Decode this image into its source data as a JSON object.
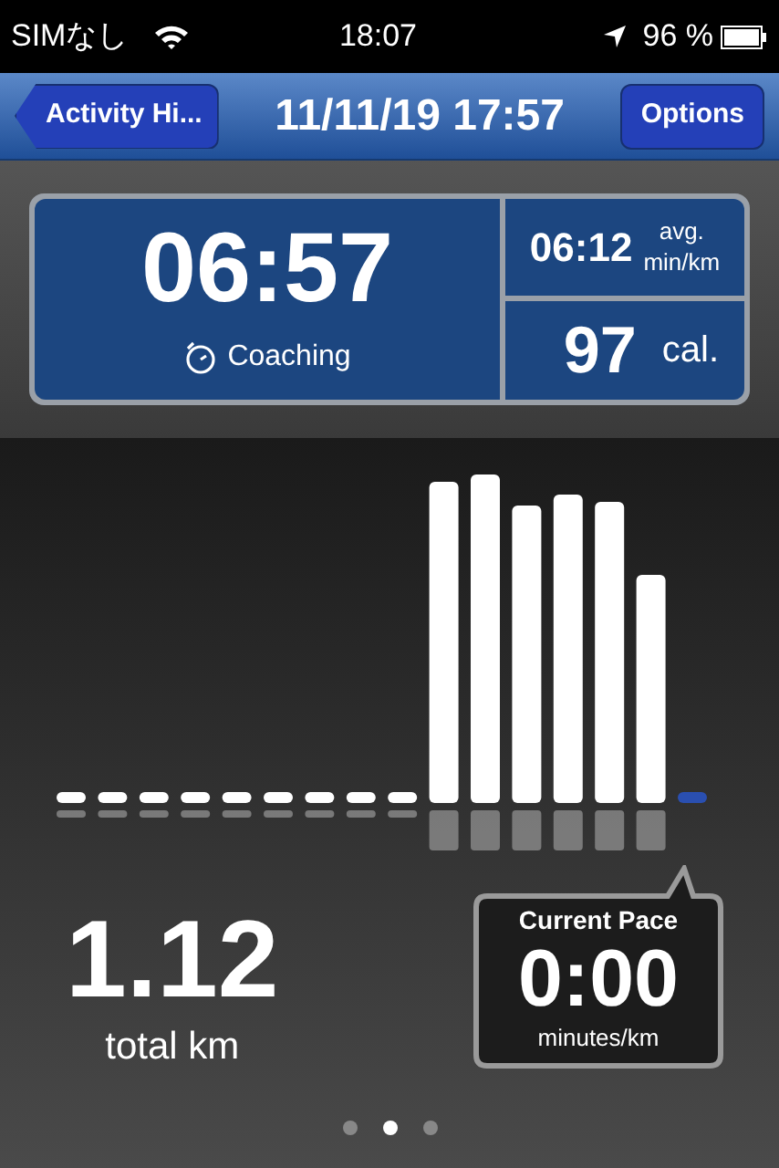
{
  "status_bar": {
    "carrier": "SIMなし",
    "time": "18:07",
    "battery": "96 %"
  },
  "nav": {
    "back": "Activity Hi...",
    "title": "11/11/19 17:57",
    "action": "Options"
  },
  "stats": {
    "duration": "06:57",
    "mode": "Coaching",
    "avg_pace": "06:12",
    "avg_label": "avg.",
    "avg_unit": "min/km",
    "calories": "97",
    "calories_unit": "cal."
  },
  "distance": {
    "value": "1.12",
    "unit": "total km"
  },
  "current_pace": {
    "title": "Current Pace",
    "value": "0:00",
    "unit": "minutes/km"
  },
  "pages": [
    {
      "selected": false
    },
    {
      "selected": true
    },
    {
      "selected": false
    }
  ]
}
